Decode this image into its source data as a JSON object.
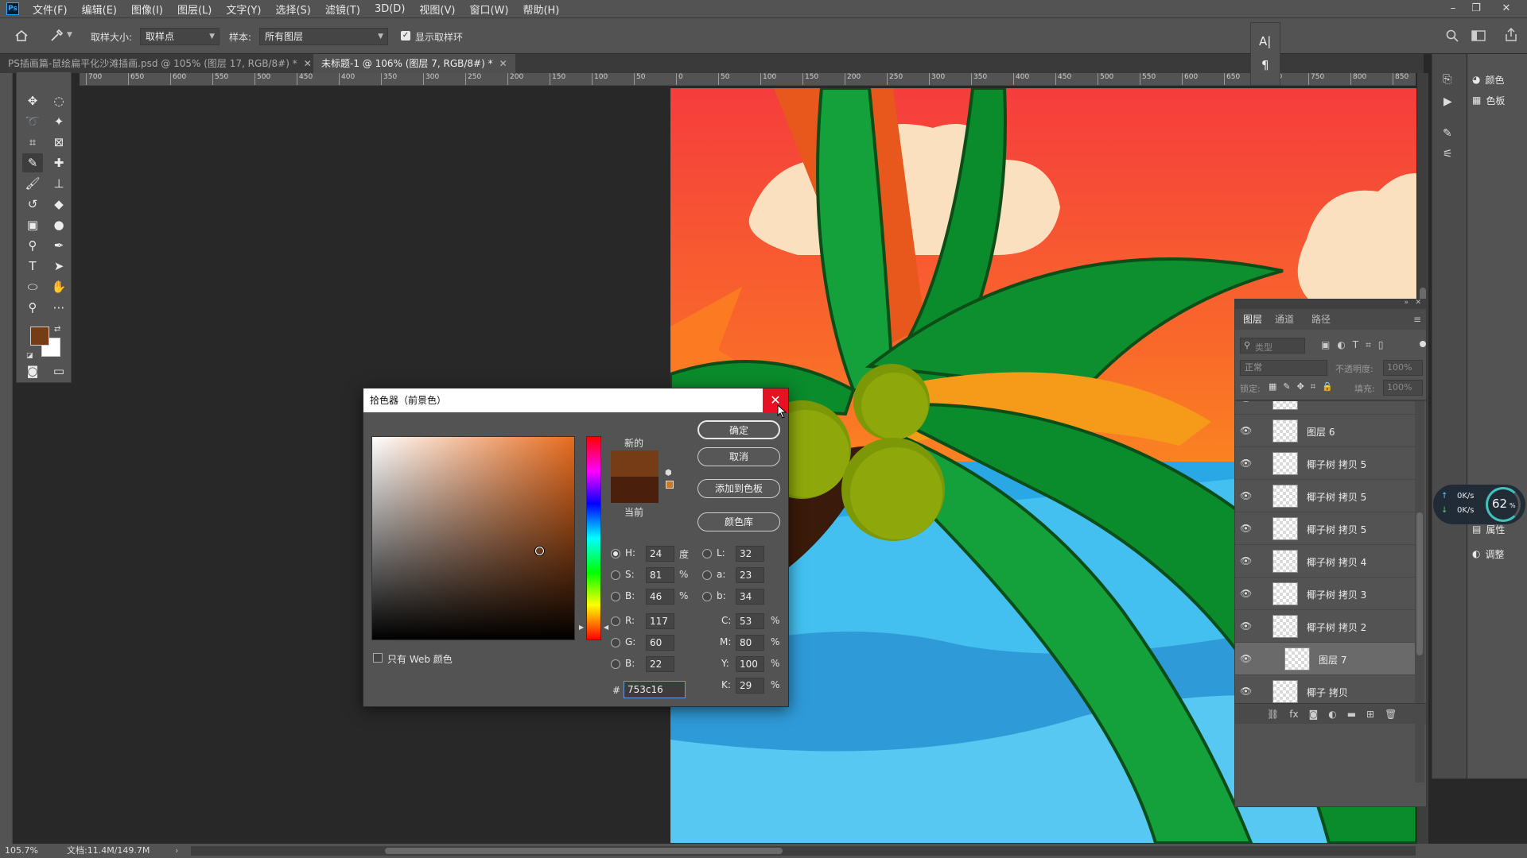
{
  "app": {
    "logo": "Ps"
  },
  "menu": [
    "文件(F)",
    "编辑(E)",
    "图像(I)",
    "图层(L)",
    "文字(Y)",
    "选择(S)",
    "滤镜(T)",
    "3D(D)",
    "视图(V)",
    "窗口(W)",
    "帮助(H)"
  ],
  "window_controls": {
    "minimize": "–",
    "restore": "❐",
    "close": "✕"
  },
  "options": {
    "sample_size_label": "取样大小:",
    "sample_size_value": "取样点",
    "sample_label": "样本:",
    "sample_value": "所有图层",
    "show_ring_label": "显示取样环",
    "show_ring_checked": true
  },
  "tabs": [
    {
      "label": "PS插画篇-鼠绘扁平化沙滩插画.psd @ 105% (图层 17, RGB/8#) *",
      "active": false
    },
    {
      "label": "未标题-1 @ 106% (图层 7, RGB/8#) *",
      "active": true
    }
  ],
  "ruler_labels": [
    "700",
    "650",
    "600",
    "550",
    "500",
    "450",
    "400",
    "350",
    "300",
    "250",
    "200",
    "150",
    "100",
    "50",
    "0",
    "50",
    "100",
    "150",
    "200",
    "250",
    "300",
    "350",
    "400",
    "450",
    "500",
    "550",
    "600",
    "650",
    "700",
    "750",
    "800",
    "850"
  ],
  "foreground_color": "#753c16",
  "background_color": "#ffffff",
  "char_panel": {
    "text_icon": "A|",
    "para_icon": "¶"
  },
  "dock": {
    "color_label": "颜色",
    "swatches_label": "色板",
    "adjust_label": "调整",
    "properties_label": "属性"
  },
  "network_widget": {
    "up": "0K/s",
    "down": "0K/s",
    "percent": "62",
    "percent_sign": "%"
  },
  "layers_panel": {
    "tabs": [
      "图层",
      "通道",
      "路径"
    ],
    "search_placeholder": "类型",
    "blend_mode": "正常",
    "opacity_label": "不透明度:",
    "opacity_value": "100%",
    "lock_label": "锁定:",
    "fill_label": "填充:",
    "fill_value": "100%",
    "layers": [
      {
        "name": "图层 6",
        "selected": false
      },
      {
        "name": "椰子树 拷贝 5",
        "selected": false
      },
      {
        "name": "椰子树 拷贝 5",
        "selected": false
      },
      {
        "name": "椰子树 拷贝 5",
        "selected": false
      },
      {
        "name": "椰子树 拷贝 4",
        "selected": false
      },
      {
        "name": "椰子树 拷贝 3",
        "selected": false
      },
      {
        "name": "椰子树 拷贝 2",
        "selected": false
      },
      {
        "name": "图层 7",
        "selected": true
      },
      {
        "name": "椰子 拷贝",
        "selected": false
      }
    ]
  },
  "color_picker": {
    "title": "拾色器（前景色）",
    "new_label": "新的",
    "current_label": "当前",
    "new_color": "#753c16",
    "current_color": "#4a1f0c",
    "buttons": {
      "ok": "确定",
      "cancel": "取消",
      "add_swatch": "添加到色板",
      "libraries": "颜色库"
    },
    "web_only_label": "只有 Web 颜色",
    "fields": {
      "H": "24",
      "S": "81",
      "B": "46",
      "R": "117",
      "G": "60",
      "B2": "22",
      "L": "32",
      "a": "23",
      "b": "34",
      "C": "53",
      "M": "80",
      "Y": "100",
      "K": "29"
    },
    "units": {
      "deg": "度",
      "pct": "%"
    },
    "hex": "753c16"
  },
  "status": {
    "zoom": "105.7%",
    "doc": "文档:11.4M/149.7M"
  }
}
